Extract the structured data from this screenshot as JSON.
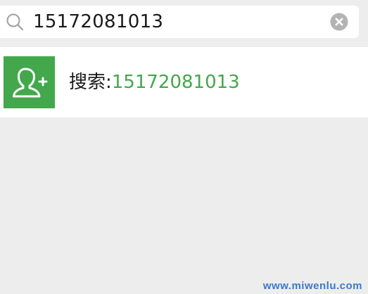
{
  "search": {
    "value": "15172081013",
    "search_icon": "search-icon",
    "clear_icon": "clear-icon"
  },
  "result": {
    "icon": "add-contact-icon",
    "prefix": "搜索:",
    "number": "15172081013"
  },
  "watermark": "www.miwenlu.com",
  "colors": {
    "background": "#ededed",
    "accent_green": "#43a84b",
    "text": "#1a1a1a",
    "watermark": "#3b78c9"
  }
}
